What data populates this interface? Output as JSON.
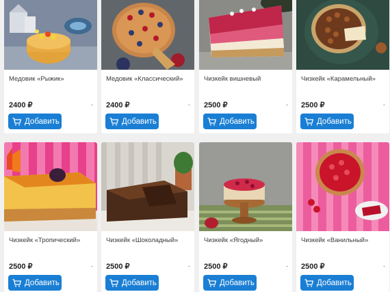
{
  "products": [
    {
      "name": "Медовик «Рыжик»",
      "price": "2400 ₽",
      "qty": "-",
      "add_label": "Добавить",
      "image_icon": "honey-cake-photo"
    },
    {
      "name": "Медовик «Классический»",
      "price": "2400 ₽",
      "qty": "-",
      "add_label": "Добавить",
      "image_icon": "berry-honey-cake-photo"
    },
    {
      "name": "Чизкейк вишневый",
      "price": "2500 ₽",
      "qty": "-",
      "add_label": "Добавить",
      "image_icon": "cherry-cheesecake-photo"
    },
    {
      "name": "Чизкейк «Карамельный»",
      "price": "2500 ₽",
      "qty": "-",
      "add_label": "Добавить",
      "image_icon": "caramel-cheesecake-photo"
    },
    {
      "name": "Чизкейк «Тропический»",
      "price": "2500 ₽",
      "qty": "-",
      "add_label": "Добавить",
      "image_icon": "tropical-cheesecake-photo"
    },
    {
      "name": "Чизкейк «Шоколадный»",
      "price": "2500 ₽",
      "qty": "-",
      "add_label": "Добавить",
      "image_icon": "chocolate-cheesecake-photo"
    },
    {
      "name": "Чизкейк «Ягодный»",
      "price": "2500 ₽",
      "qty": "-",
      "add_label": "Добавить",
      "image_icon": "berry-cheesecake-photo"
    },
    {
      "name": "Чизкейк «Ванильный»",
      "price": "2500 ₽",
      "qty": "-",
      "add_label": "Добавить",
      "image_icon": "vanilla-cheesecake-photo"
    }
  ],
  "colors": {
    "button": "#1a7fd4",
    "card": "#ffffff",
    "background": "#f0f0f0"
  }
}
